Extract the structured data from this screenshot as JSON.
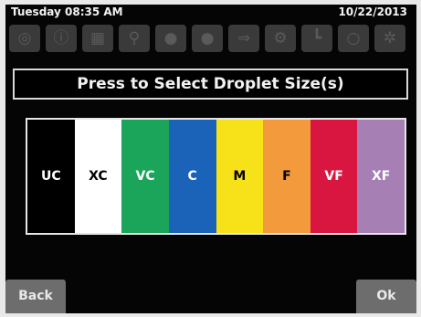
{
  "status": {
    "time": "Tuesday 08:35 AM",
    "date": "10/22/2013"
  },
  "toolbar_icons": [
    {
      "name": "tire-icon",
      "glyph": "◎"
    },
    {
      "name": "warning-icon",
      "glyph": "ⓘ"
    },
    {
      "name": "calibration-icon",
      "glyph": "▦"
    },
    {
      "name": "tank-icon",
      "glyph": "⚲"
    },
    {
      "name": "pump-icon",
      "glyph": "●"
    },
    {
      "name": "flow-icon",
      "glyph": "●"
    },
    {
      "name": "boom-icon",
      "glyph": "⇒"
    },
    {
      "name": "settings-icon",
      "glyph": "⚙"
    },
    {
      "name": "valve-icon",
      "glyph": "┗"
    },
    {
      "name": "nozzle-icon",
      "glyph": "○"
    },
    {
      "name": "gear-icon",
      "glyph": "✲"
    }
  ],
  "title": "Press to Select Droplet Size(s)",
  "droplets": [
    {
      "label": "UC",
      "color": "#000000",
      "text_color": "#ffffff"
    },
    {
      "label": "XC",
      "color": "#ffffff",
      "text_color": "#000000"
    },
    {
      "label": "VC",
      "color": "#1aa55a",
      "text_color": "#ffffff"
    },
    {
      "label": "C",
      "color": "#1b63b8",
      "text_color": "#ffffff"
    },
    {
      "label": "M",
      "color": "#f7e21a",
      "text_color": "#000000"
    },
    {
      "label": "F",
      "color": "#f39a3c",
      "text_color": "#000000"
    },
    {
      "label": "VF",
      "color": "#d9163f",
      "text_color": "#ffffff"
    },
    {
      "label": "XF",
      "color": "#a67fb5",
      "text_color": "#ffffff"
    }
  ],
  "buttons": {
    "back": "Back",
    "ok": "Ok"
  }
}
